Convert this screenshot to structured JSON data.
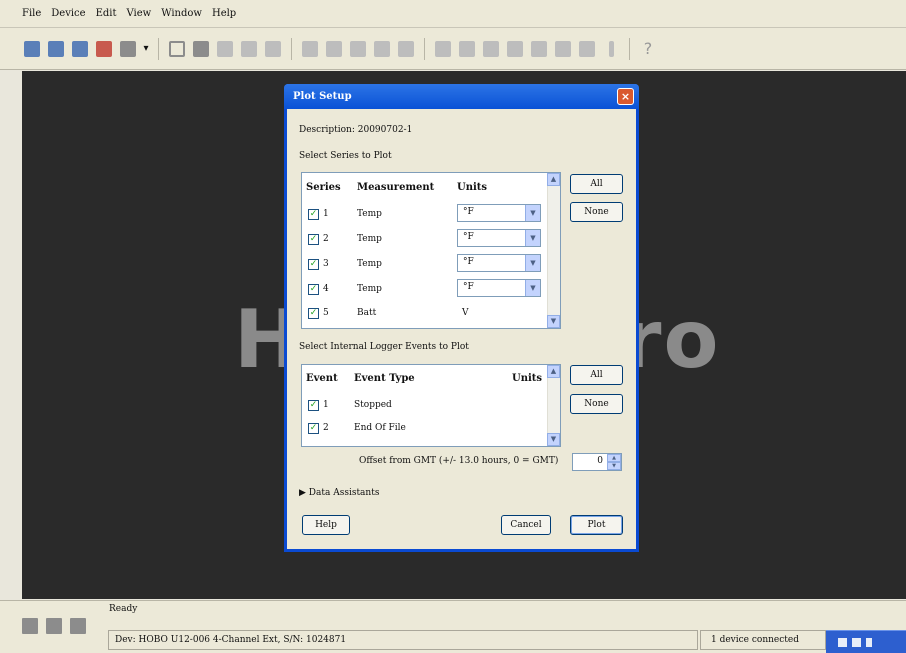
{
  "menu": [
    "File",
    "Device",
    "Edit",
    "View",
    "Window",
    "Help"
  ],
  "background_watermark": {
    "left": "HO",
    "right": "ro"
  },
  "status": {
    "ready": "Ready",
    "device": "Dev: HOBO U12-006 4-Channel Ext, S/N: 1024871",
    "connected": "1 device connected"
  },
  "dialog": {
    "title": "Plot Setup",
    "close_glyph": "×",
    "description": "Description: 20090702-1",
    "series_label": "Select Series to Plot",
    "series_headers": {
      "series": "Series",
      "measurement": "Measurement",
      "units": "Units"
    },
    "series": [
      {
        "num": "1",
        "measurement": "Temp",
        "unit": "°F",
        "combo": true
      },
      {
        "num": "2",
        "measurement": "Temp",
        "unit": "°F",
        "combo": true
      },
      {
        "num": "3",
        "measurement": "Temp",
        "unit": "°F",
        "combo": true
      },
      {
        "num": "4",
        "measurement": "Temp",
        "unit": "°F",
        "combo": true
      },
      {
        "num": "5",
        "measurement": "Batt",
        "unit": "V",
        "combo": false
      }
    ],
    "all_label": "All",
    "none_label": "None",
    "events_label": "Select Internal Logger Events to Plot",
    "event_headers": {
      "event": "Event",
      "type": "Event Type",
      "units": "Units"
    },
    "events": [
      {
        "num": "1",
        "type": "Stopped"
      },
      {
        "num": "2",
        "type": "End Of File"
      }
    ],
    "offset_label": "Offset from GMT (+/- 13.0 hours, 0 = GMT)",
    "offset_value": "0",
    "data_assistants": "▶ Data Assistants",
    "help_label": "Help",
    "cancel_label": "Cancel",
    "plot_label": "Plot"
  }
}
